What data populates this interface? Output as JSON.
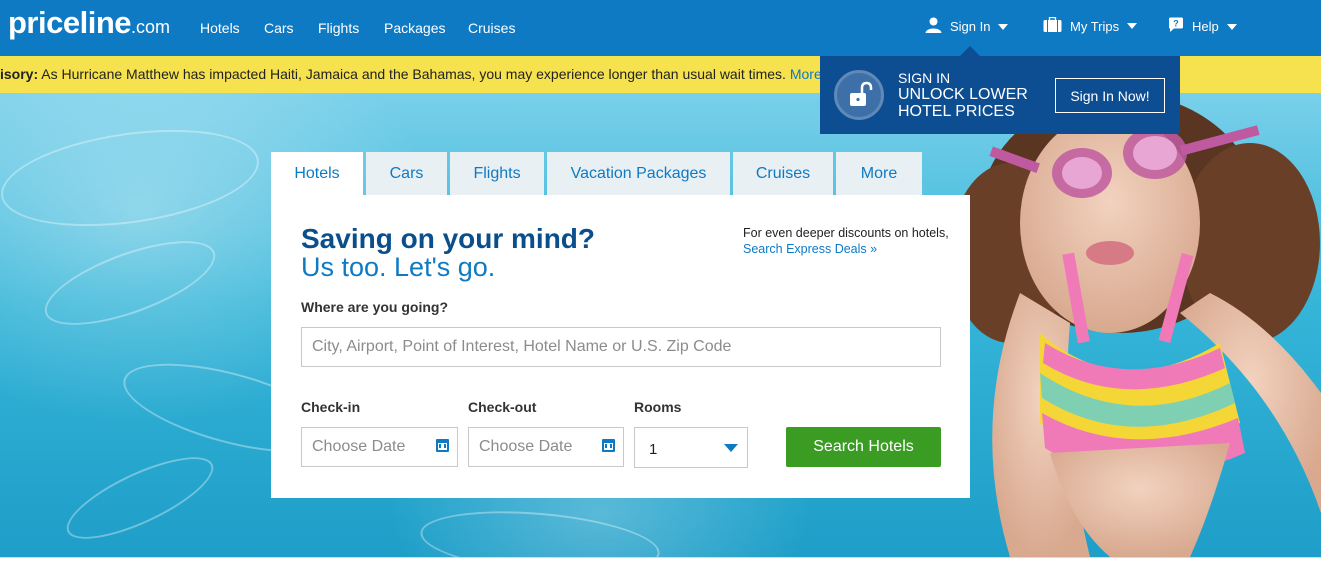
{
  "header": {
    "logo_main": "priceline",
    "logo_suffix": ".com",
    "nav": [
      "Hotels",
      "Cars",
      "Flights",
      "Packages",
      "Cruises"
    ],
    "sign_in": "Sign In",
    "my_trips": "My Trips",
    "help": "Help",
    "icons": [
      "user-icon",
      "suitcase-icon",
      "help-bubble-icon"
    ]
  },
  "advisory": {
    "prefix": "isory:",
    "message": " As Hurricane Matthew has impacted Haiti, Jamaica and the Bahamas, you may experience longer than usual wait times.",
    "more_link": "More"
  },
  "signin_popup": {
    "line1": "SIGN IN",
    "line2": "UNLOCK LOWER",
    "line3": "HOTEL PRICES",
    "button": "Sign In Now!"
  },
  "search": {
    "tabs": [
      "Hotels",
      "Cars",
      "Flights",
      "Vacation Packages",
      "Cruises",
      "More"
    ],
    "active_tab": "Hotels",
    "headline": "Saving on your mind?",
    "subheadline": "Us too. Let's go.",
    "deals_note": "For even deeper discounts on hotels,",
    "deals_link": "Search Express Deals »",
    "destination_label": "Where are you going?",
    "destination_placeholder": "City, Airport, Point of Interest, Hotel Name or U.S. Zip Code",
    "checkin_label": "Check-in",
    "checkin_placeholder": "Choose Date",
    "checkout_label": "Check-out",
    "checkout_placeholder": "Choose Date",
    "rooms_label": "Rooms",
    "rooms_value": "1",
    "submit": "Search Hotels"
  },
  "colors": {
    "brand_blue": "#0e7ac4",
    "navy": "#0d4d91",
    "advisory_yellow": "#f6e24f",
    "cta_green": "#3a9c22"
  }
}
